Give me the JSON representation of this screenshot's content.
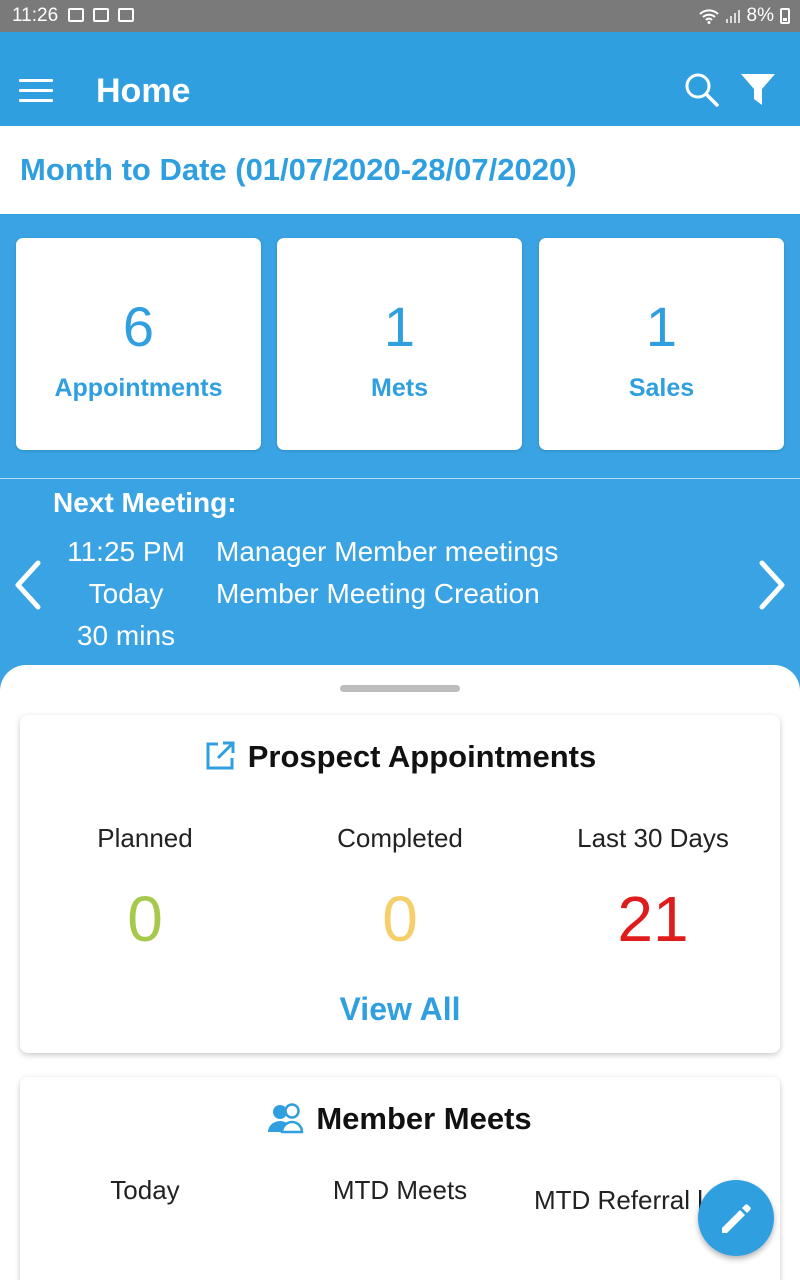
{
  "status_bar": {
    "time": "11:26",
    "battery": "8%"
  },
  "app_bar": {
    "title": "Home"
  },
  "date_range": "Month to Date (01/07/2020-28/07/2020)",
  "stats": [
    {
      "value": "6",
      "label": "Appointments"
    },
    {
      "value": "1",
      "label": "Mets"
    },
    {
      "value": "1",
      "label": "Sales"
    }
  ],
  "next_meeting": {
    "title": "Next Meeting:",
    "time": "11:25 PM",
    "day": "Today",
    "duration": "30 mins",
    "name": "Manager Member meetings",
    "type": "Member Meeting Creation"
  },
  "prospect": {
    "title": "Prospect Appointments",
    "columns": [
      {
        "label": "Planned",
        "value": "0",
        "color": "#a6c84c"
      },
      {
        "label": "Completed",
        "value": "0",
        "color": "#f5cf6a"
      },
      {
        "label": "Last 30 Days",
        "value": "21",
        "color": "#e01b1b"
      }
    ],
    "view_all": "View All"
  },
  "member_meets": {
    "title": "Member Meets",
    "columns": [
      {
        "label": "Today",
        "color": "#a6c84c"
      },
      {
        "label": "MTD Meets",
        "color": "#f5cf6a"
      },
      {
        "label": "MTD Referral l",
        "color": "#e01b1b"
      }
    ]
  }
}
